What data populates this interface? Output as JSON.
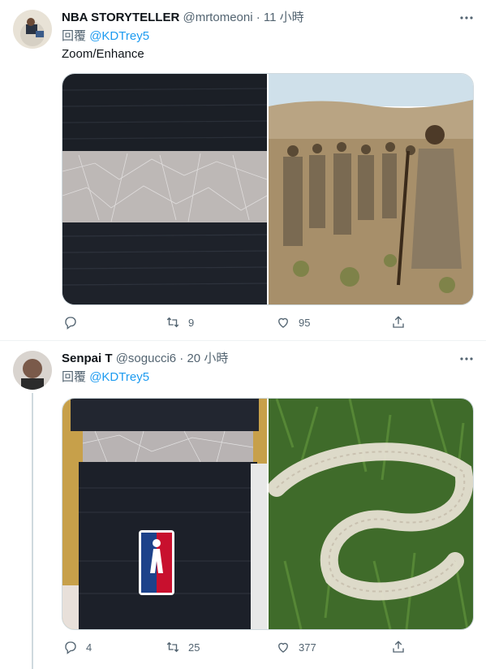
{
  "tweets": [
    {
      "name": "NBA STORYTELLER",
      "handle": "@mrtomeoni",
      "dot": "·",
      "time": "11 小時",
      "reply_prefix": "回覆",
      "reply_to": "@KDTrey5",
      "text": "Zoom/Enhance",
      "counts": {
        "reply": "",
        "retweet": "9",
        "like": "95"
      },
      "media": [
        "sock-closeup-photo",
        "desert-crowd-photo"
      ]
    },
    {
      "name": "Senpai T",
      "handle": "@sogucci6",
      "dot": "·",
      "time": "20 小時",
      "reply_prefix": "回覆",
      "reply_to": "@KDTrey5",
      "text": "",
      "counts": {
        "reply": "4",
        "retweet": "25",
        "like": "377"
      },
      "media": [
        "nba-sock-photo",
        "snake-skin-photo"
      ]
    }
  ],
  "colors": {
    "link": "#1d9bf0",
    "secondary": "#536471",
    "border": "#cfd9de"
  },
  "icons": [
    "more-icon",
    "reply-icon",
    "retweet-icon",
    "like-icon",
    "share-icon"
  ]
}
